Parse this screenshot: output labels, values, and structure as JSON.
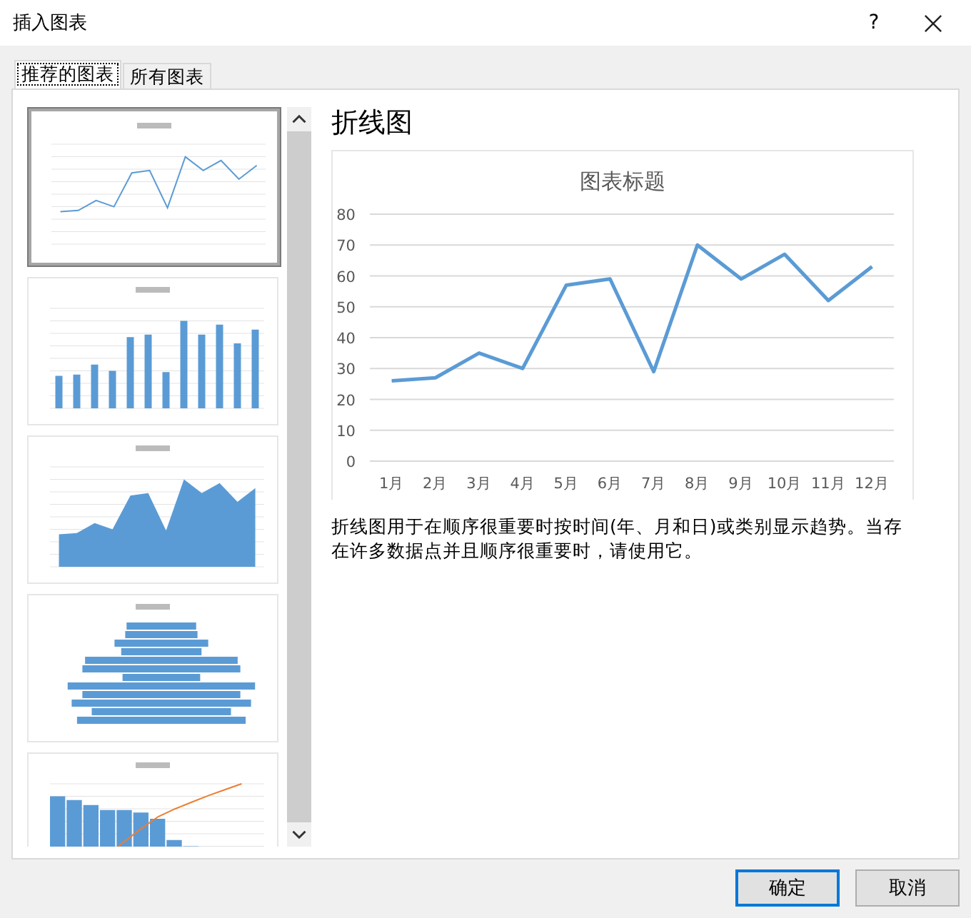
{
  "window": {
    "title": "插入图表",
    "help": "?"
  },
  "tabs": [
    {
      "label": "推荐的图表",
      "selected": true
    },
    {
      "label": "所有图表",
      "selected": false
    }
  ],
  "thumbnails": [
    {
      "kind": "line",
      "selected": true
    },
    {
      "kind": "column",
      "selected": false
    },
    {
      "kind": "area",
      "selected": false
    },
    {
      "kind": "bar",
      "selected": false
    },
    {
      "kind": "pareto",
      "selected": false
    }
  ],
  "preview": {
    "heading": "折线图",
    "chart_data": {
      "type": "line",
      "title": "图表标题",
      "categories": [
        "1月",
        "2月",
        "3月",
        "4月",
        "5月",
        "6月",
        "7月",
        "8月",
        "9月",
        "10月",
        "11月",
        "12月"
      ],
      "series": [
        {
          "color": "#5b9bd5",
          "values": [
            26,
            27,
            35,
            30,
            57,
            59,
            29,
            70,
            59,
            67,
            52,
            63
          ]
        }
      ],
      "grid": true,
      "ylim": [
        0,
        80
      ],
      "yticks": [
        0,
        10,
        20,
        30,
        40,
        50,
        60,
        70,
        80
      ]
    },
    "description": "折线图用于在顺序很重要时按时间(年、月和日)或类别显示趋势。当存在许多数据点并且顺序很重要时，请使用它。"
  },
  "buttons": [
    {
      "label": "确定",
      "default": true
    },
    {
      "label": "取消",
      "default": false
    }
  ]
}
